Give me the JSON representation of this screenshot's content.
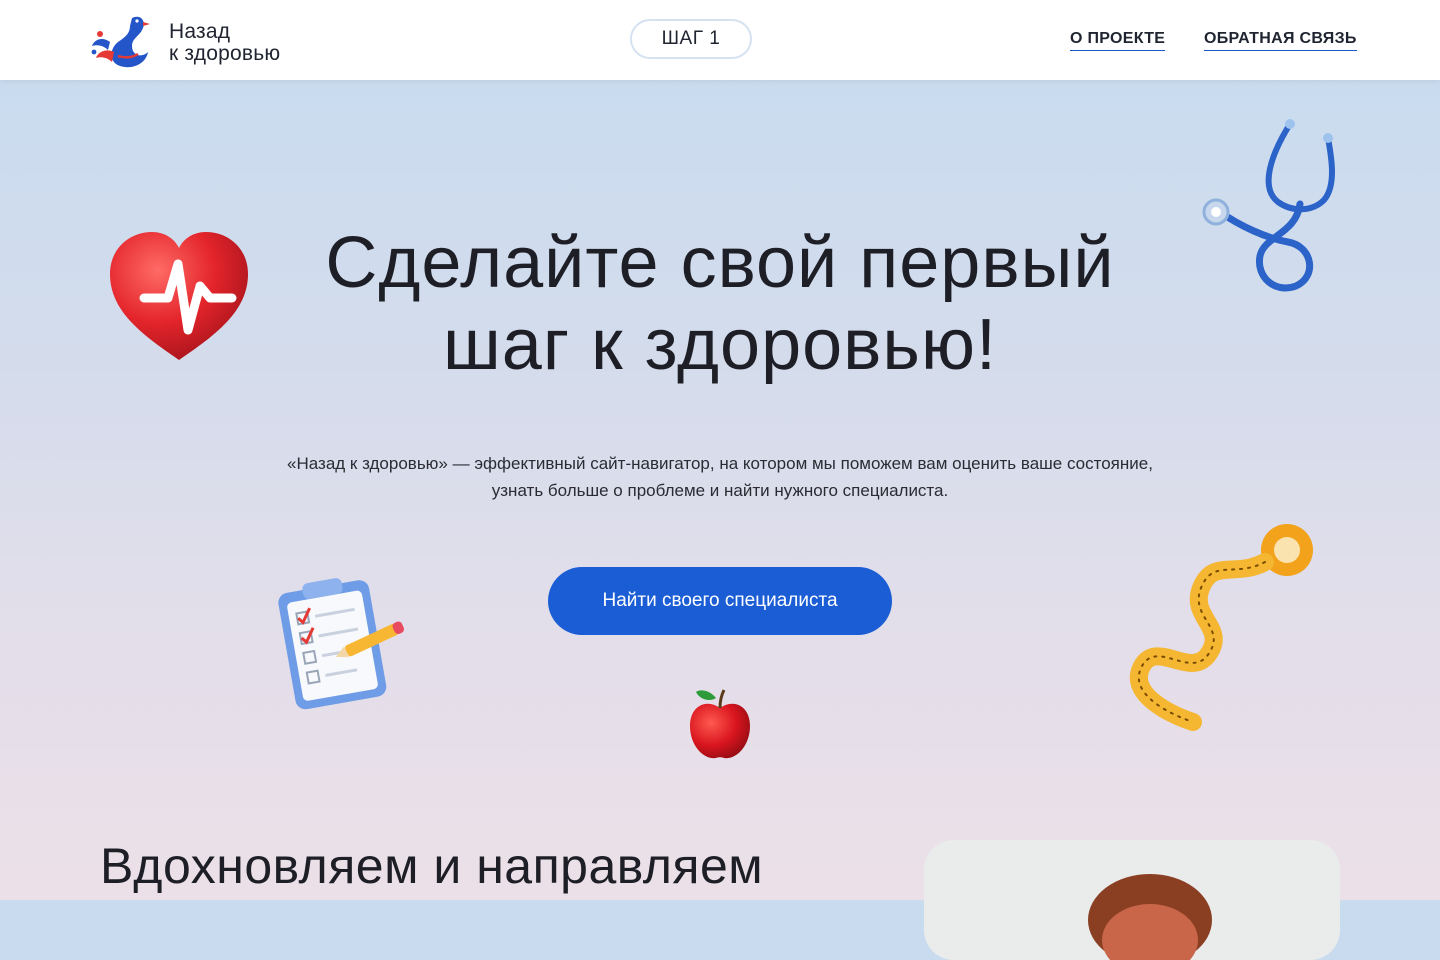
{
  "header": {
    "logo": {
      "line1": "Назад",
      "line2": "к здоровью"
    },
    "step_label": "ШАГ 1",
    "nav": {
      "about": "О ПРОЕКТЕ",
      "feedback": "ОБРАТНАЯ СВЯЗЬ"
    }
  },
  "hero": {
    "title_line1": "Сделайте свой первый",
    "title_line2": "шаг к здоровью!",
    "description": "«Назад к здоровью» — эффективный сайт-навигатор, на котором мы поможем вам оценить ваше состояние, узнать больше о проблеме и найти нужного специалиста.",
    "cta_label": "Найти своего специалиста",
    "decorations": [
      "heart-icon",
      "stethoscope-icon",
      "clipboard-checklist-icon",
      "measuring-tape-icon",
      "apple-icon"
    ]
  },
  "section": {
    "title": "Вдохновляем и направляем"
  },
  "colors": {
    "accent": "#1a5dd4",
    "heading": "#1e1f26",
    "background_top": "#c9dcef",
    "background_bottom": "#ece0e8"
  }
}
